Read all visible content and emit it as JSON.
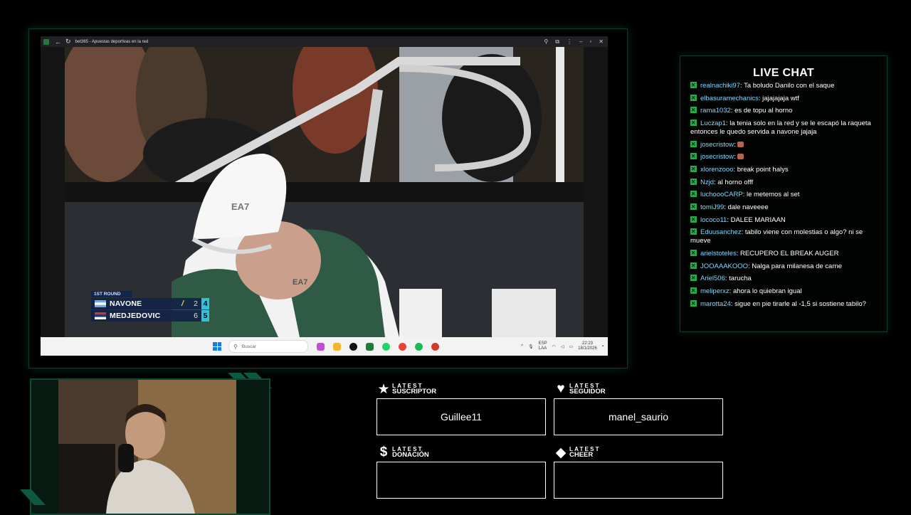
{
  "browser": {
    "title": "bet365 - Apuestas deportivas en la red"
  },
  "scoreboard": {
    "round": "1ST ROUND",
    "players": [
      {
        "name": "NAVONE",
        "sets": "2",
        "games": "4",
        "serving": true,
        "flag": "argentina"
      },
      {
        "name": "MEDJEDOVIC",
        "sets": "6",
        "games": "5",
        "serving": false,
        "flag": "serbia"
      }
    ]
  },
  "video": {
    "cap_logo": "EA7",
    "shirt_logo": "EA7"
  },
  "taskbar": {
    "search_placeholder": "Buscar",
    "lang_top": "ESP",
    "lang_bottom": "LAA",
    "time": "22:23",
    "date": "18/1/2026"
  },
  "chat": {
    "title": "LIVE CHAT",
    "messages": [
      {
        "user": "realnachiki97",
        "text": "Ta boludo Danilo con el saque"
      },
      {
        "user": "elbasuramechanics",
        "text": "jajajajaja wtf"
      },
      {
        "user": "rama1032",
        "text": "es de topu al horno"
      },
      {
        "user": "Luczap1",
        "text": "la tenia solo en la red y se le escapó la raqueta entonces le quedo servida a navone jajaja"
      },
      {
        "user": "josecristow",
        "text": "",
        "emote": true
      },
      {
        "user": "josecristow",
        "text": "",
        "emote": true
      },
      {
        "user": "xlorenzooo",
        "text": "break point halys"
      },
      {
        "user": "Nzjd",
        "text": "al horno offf"
      },
      {
        "user": "luchoooCARP",
        "text": "le metemos al set"
      },
      {
        "user": "tomiJ99",
        "text": "dale naveeee"
      },
      {
        "user": "lococo11",
        "text": "DALEE MARIAAN"
      },
      {
        "user": "Eduusanchez",
        "text": "tabilo viene con molestias o algo? ni se mueve"
      },
      {
        "user": "arielstoteles",
        "text": "RECUPERO EL BREAK AUGER"
      },
      {
        "user": "JOOAAAKOOO",
        "text": "Nalga para milanesa de carne"
      },
      {
        "user": "Ariel506",
        "text": "tarucha"
      },
      {
        "user": "meliperxz",
        "text": "ahora lo quiebran igual"
      },
      {
        "user": "marotta24",
        "text": "sigue en pie tirarle al -1,5 si sostiene tabilo?"
      }
    ]
  },
  "latest": {
    "suscriptor": {
      "small": "LATEST",
      "big": "SUSCRIPTOR",
      "value": "Guillee11"
    },
    "seguidor": {
      "small": "LATEST",
      "big": "SEGUIDOR",
      "value": "manel_saurio"
    },
    "donacion": {
      "small": "LATEST",
      "big": "DONACIÓN",
      "value": ""
    },
    "cheer": {
      "small": "LATEST",
      "big": "CHEER",
      "value": ""
    }
  },
  "colors": {
    "frame_green": "#0f3b2d",
    "chat_user": "#7fd7ff",
    "score_accent": "#2ec4d6"
  }
}
